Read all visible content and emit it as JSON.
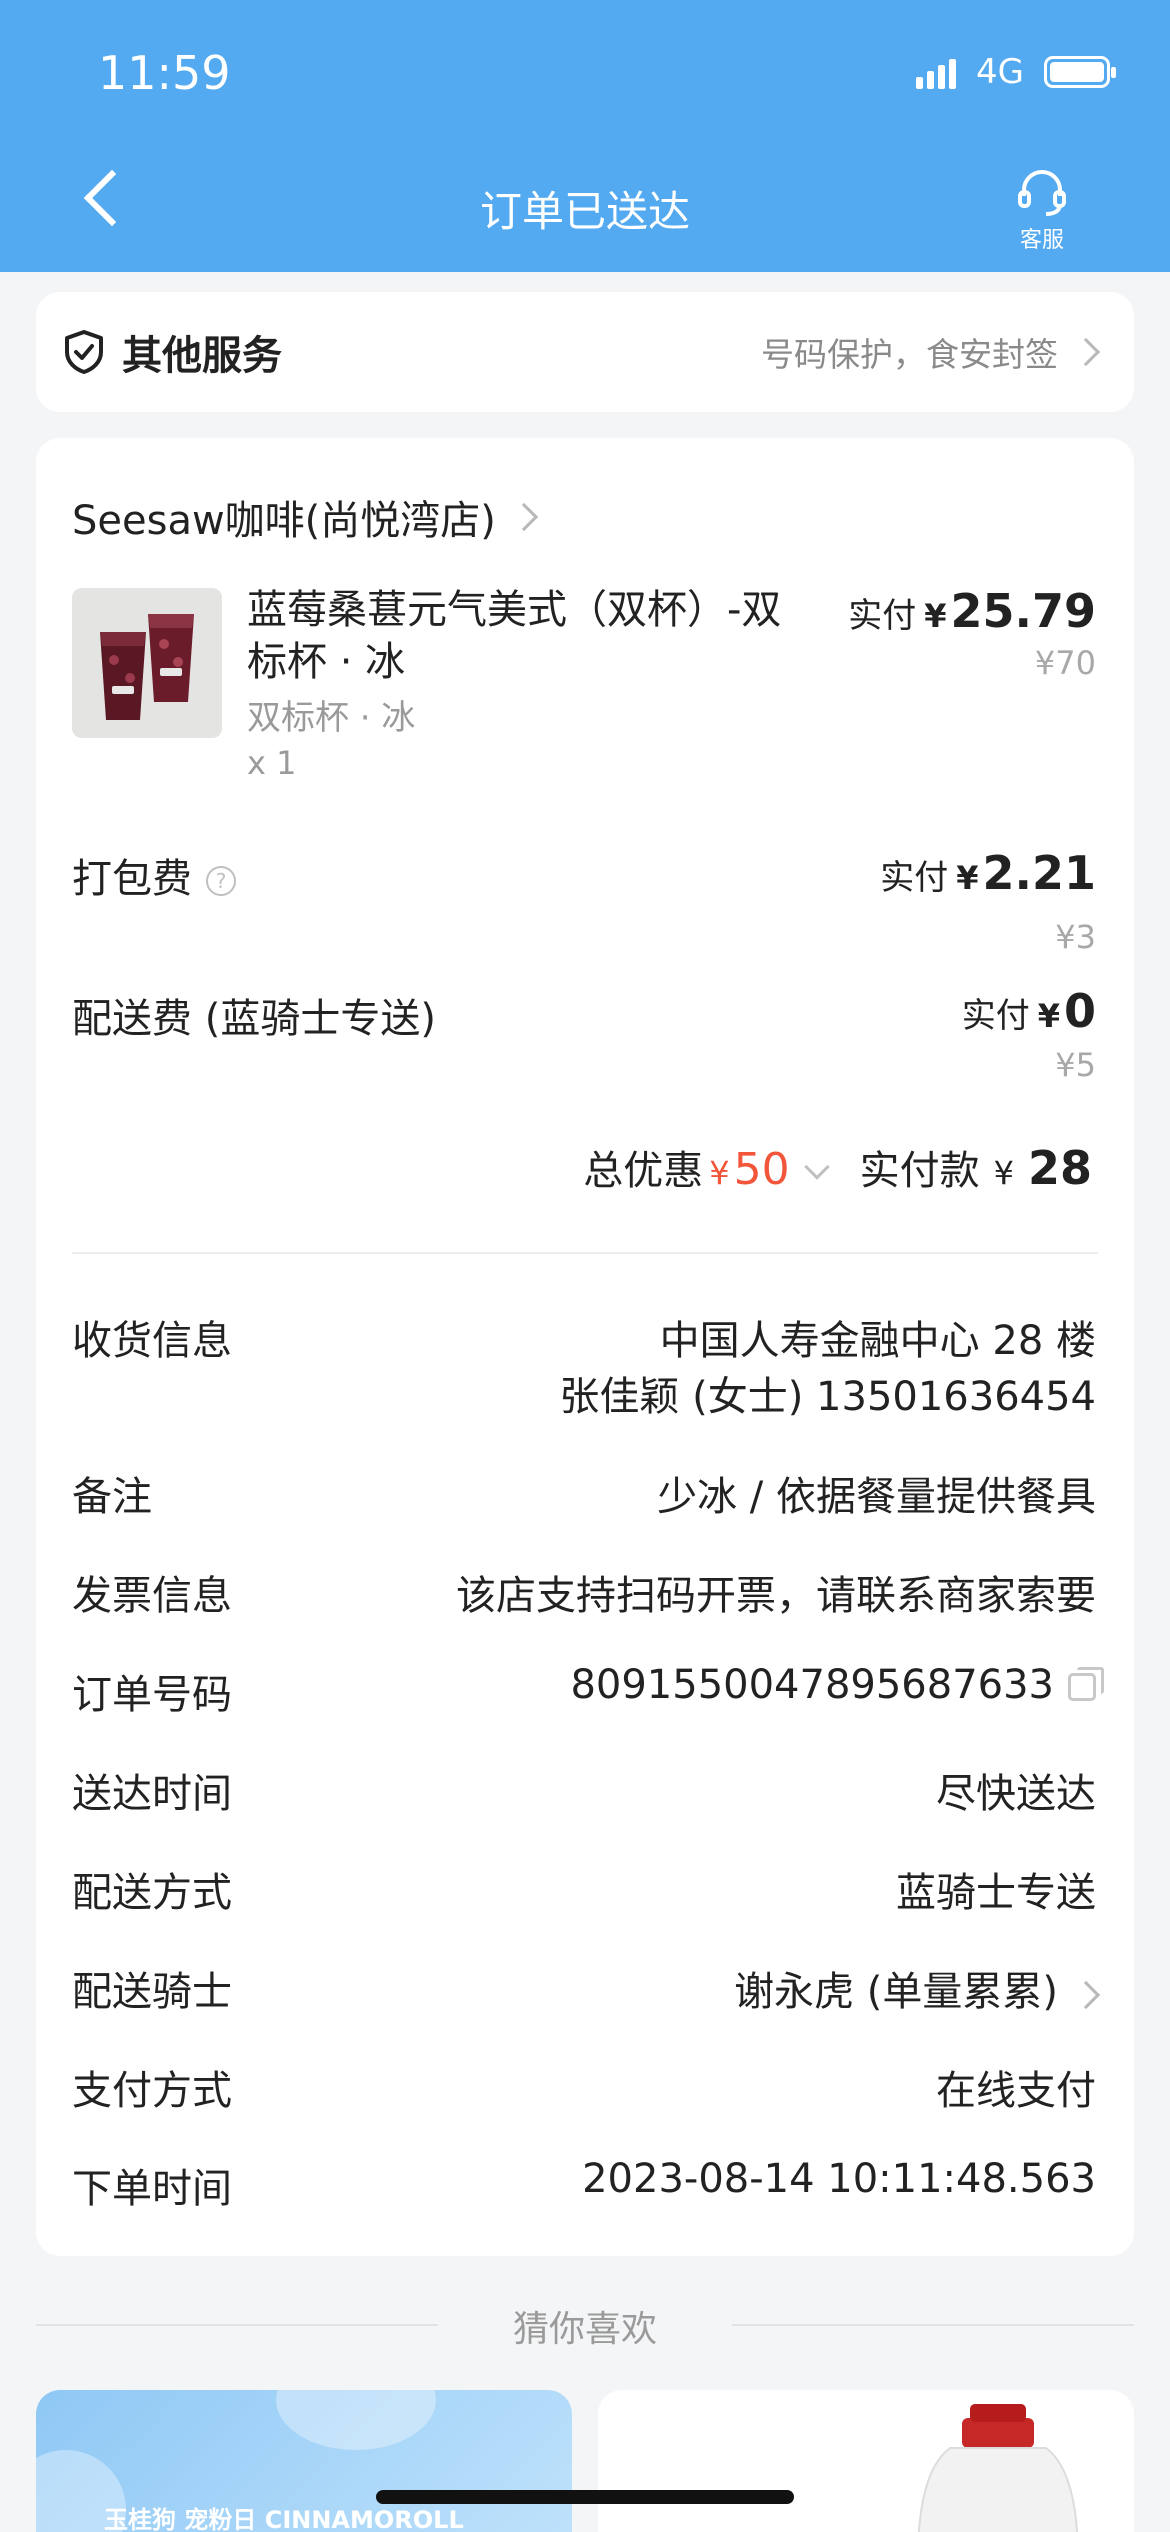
{
  "status_bar": {
    "time": "11:59",
    "network": "4G"
  },
  "header": {
    "title": "订单已送达",
    "service_label": "客服"
  },
  "other_services": {
    "title": "其他服务",
    "subtitle": "号码保护，食安封签"
  },
  "shop": {
    "name": "Seesaw咖啡(尚悦湾店)"
  },
  "item": {
    "name": "蓝莓桑葚元气美式（双杯）-双标杯 · 冰",
    "spec": "双标杯 · 冰",
    "qty": "x 1",
    "paid_label": "实付",
    "currency": "¥",
    "paid": "25.79",
    "original": "¥70"
  },
  "fees": {
    "packing": {
      "label": "打包费",
      "help": "?",
      "paid_label": "实付",
      "currency": "¥",
      "paid": "2.21",
      "original": "¥3"
    },
    "delivery": {
      "label": "配送费 (蓝骑士专送)",
      "paid_label": "实付",
      "currency": "¥",
      "paid": "0",
      "original": "¥5"
    }
  },
  "totals": {
    "discount_label": "总优惠",
    "discount_currency": "¥",
    "discount": "50",
    "pay_label": "实付款",
    "pay_currency": "¥",
    "pay": "28"
  },
  "details": {
    "address": {
      "label": "收货信息",
      "line1": "中国人寿金融中心 28 楼",
      "line2": "张佳颖 (女士) 13501636454"
    },
    "remark": {
      "label": "备注",
      "value": "少冰 / 依据餐量提供餐具"
    },
    "invoice": {
      "label": "发票信息",
      "value": "该店支持扫码开票，请联系商家索要"
    },
    "order_no": {
      "label": "订单号码",
      "value": "8091550047895687633"
    },
    "arrival": {
      "label": "送达时间",
      "value": "尽快送达"
    },
    "method": {
      "label": "配送方式",
      "value": "蓝骑士专送"
    },
    "rider": {
      "label": "配送骑士",
      "value": "谢永虎 (单量累累)"
    },
    "payment": {
      "label": "支付方式",
      "value": "在线支付"
    },
    "order_time": {
      "label": "下单时间",
      "value": "2023-08-14 10:11:48.563"
    }
  },
  "recommend": {
    "title": "猜你喜欢",
    "card1_text": "玉桂狗 宠粉日 CINNAMOROLL"
  },
  "colors": {
    "header": "#54aaf0",
    "discount": "#f2553a",
    "background": "#f4f5f7"
  },
  "icons": [
    "back-icon",
    "headset-icon",
    "shield-check-icon",
    "chevron-right-icon",
    "help-icon",
    "chevron-down-icon",
    "copy-icon"
  ]
}
